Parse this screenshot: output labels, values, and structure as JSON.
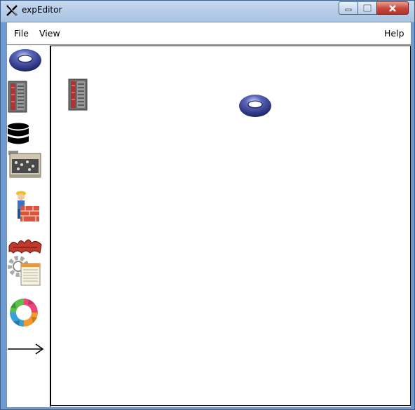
{
  "window": {
    "title": "expEditor",
    "icon": "x-logo-icon"
  },
  "title_controls": [
    "minimize-icon",
    "maximize-icon",
    "close-icon"
  ],
  "menubar": {
    "file_label": "File",
    "view_label": "View",
    "help_label": "Help"
  },
  "palette": {
    "items": [
      {
        "icon": "torus-icon"
      },
      {
        "icon": "server-rack-icon"
      },
      {
        "icon": "database-icon"
      },
      {
        "icon": "hardware-board-icon"
      },
      {
        "icon": "builder-worker-icon"
      },
      {
        "icon": "red-text-logo-icon"
      },
      {
        "icon": "settings-form-icon"
      },
      {
        "icon": "cycle-arrows-icon"
      },
      {
        "icon": "arrow-connector-icon"
      }
    ]
  },
  "canvas": {
    "nodes": [
      {
        "icon": "server-rack-icon"
      },
      {
        "icon": "torus-icon"
      }
    ]
  },
  "colors": {
    "torus_blue": "#2f3f8f",
    "rack_red": "#c0392b",
    "close_red": "#c7453a"
  }
}
